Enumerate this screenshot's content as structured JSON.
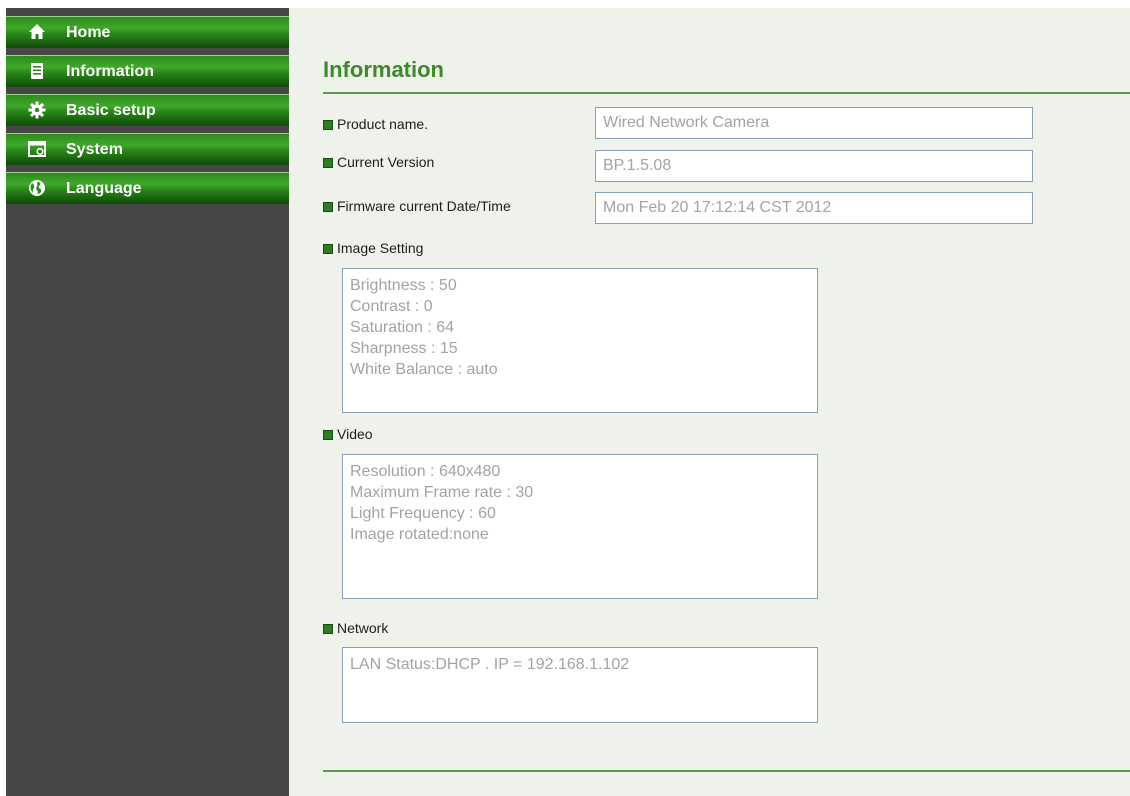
{
  "sidebar": {
    "items": [
      {
        "label": "Home",
        "icon": "home-icon"
      },
      {
        "label": "Information",
        "icon": "document-icon"
      },
      {
        "label": "Basic setup",
        "icon": "gear-icon"
      },
      {
        "label": "System",
        "icon": "system-icon"
      },
      {
        "label": "Language",
        "icon": "globe-icon"
      }
    ]
  },
  "main": {
    "title": "Information",
    "product_name": {
      "label": "Product name.",
      "value": "Wired Network Camera"
    },
    "current_version": {
      "label": "Current Version",
      "value": "BP.1.5.08"
    },
    "firmware_datetime": {
      "label": "Firmware current Date/Time",
      "value": "Mon Feb 20 17:12:14 CST 2012"
    },
    "image_setting": {
      "label": "Image Setting",
      "lines": [
        "Brightness : 50",
        "Contrast : 0",
        "Saturation : 64",
        "Sharpness : 15",
        "White Balance : auto"
      ]
    },
    "video": {
      "label": "Video",
      "lines": [
        "Resolution : 640x480",
        "Maximum Frame rate : 30",
        "Light Frequency : 60",
        "Image rotated:none"
      ]
    },
    "network": {
      "label": "Network",
      "lines": [
        "LAN Status:DHCP . IP = 192.168.1.102"
      ]
    }
  },
  "colors": {
    "nav_green": "#2f8a1d",
    "sidebar_bg": "#474747",
    "title_green": "#3e8a2a",
    "content_bg": "#eef2ea",
    "value_text": "#a3a3a3"
  }
}
